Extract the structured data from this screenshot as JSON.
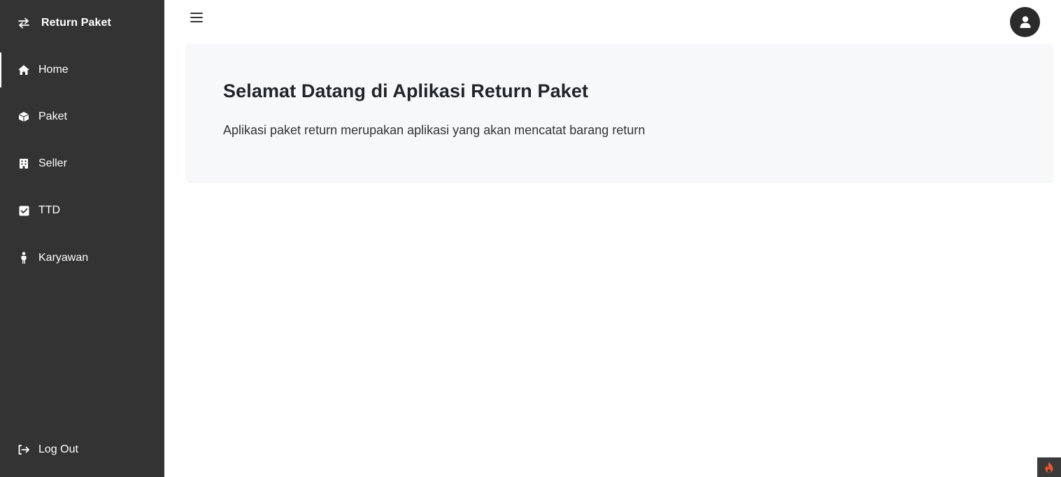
{
  "sidebar": {
    "brand": {
      "icon": "arrows-exchange-icon",
      "title": "Return Paket"
    },
    "items": [
      {
        "icon": "home-icon",
        "label": "Home",
        "active": true
      },
      {
        "icon": "box-icon",
        "label": "Paket",
        "active": false
      },
      {
        "icon": "building-icon",
        "label": "Seller",
        "active": false
      },
      {
        "icon": "check-square-icon",
        "label": "TTD",
        "active": false
      },
      {
        "icon": "person-icon",
        "label": "Karyawan",
        "active": false
      }
    ],
    "logout": {
      "icon": "sign-out-icon",
      "label": "Log Out"
    }
  },
  "topbar": {
    "menu_icon": "hamburger-icon",
    "avatar_icon": "user-avatar-icon"
  },
  "main": {
    "title": "Selamat Datang di Aplikasi Return Paket",
    "subtitle": "Aplikasi paket return merupakan aplikasi yang akan mencatat barang return"
  },
  "colors": {
    "sidebar_bg": "#333333",
    "card_bg": "#f7f8fa",
    "badge_flame": "#e8572a"
  }
}
